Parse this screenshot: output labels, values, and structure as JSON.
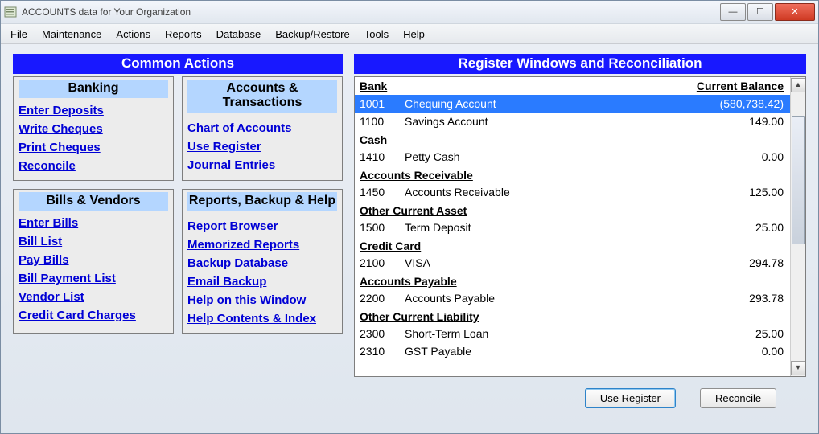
{
  "window": {
    "title": "ACCOUNTS data for Your Organization"
  },
  "menus": [
    "File",
    "Maintenance",
    "Actions",
    "Reports",
    "Database",
    "Backup/Restore",
    "Tools",
    "Help"
  ],
  "left_section_title": "Common Actions",
  "right_section_title": "Register Windows and Reconciliation",
  "panels": {
    "banking": {
      "title": "Banking",
      "links": [
        "Enter Deposits",
        "Write Cheques",
        "Print Cheques",
        "Reconcile"
      ]
    },
    "accounts_trans": {
      "title": "Accounts & Transactions",
      "links": [
        "Chart of Accounts",
        "Use Register",
        "Journal Entries"
      ]
    },
    "bills_vendors": {
      "title": "Bills & Vendors",
      "links": [
        "Enter Bills",
        "Bill List",
        "Pay Bills",
        "Bill Payment List",
        "Vendor List",
        "Credit Card Charges"
      ]
    },
    "reports_help": {
      "title": "Reports, Backup & Help",
      "links": [
        "Report Browser",
        "Memorized Reports",
        "Backup Database",
        "Email Backup",
        "Help on this Window",
        "Help Contents & Index"
      ]
    }
  },
  "register": {
    "headers": {
      "bank": "Bank",
      "balance": "Current Balance"
    },
    "groups": [
      {
        "category": "Bank",
        "show_header_balance": true,
        "accounts": [
          {
            "code": "1001",
            "name": "Chequing Account",
            "balance": "(580,738.42)",
            "selected": true
          },
          {
            "code": "1100",
            "name": "Savings Account",
            "balance": "149.00"
          }
        ]
      },
      {
        "category": "Cash",
        "accounts": [
          {
            "code": "1410",
            "name": "Petty Cash",
            "balance": "0.00"
          }
        ]
      },
      {
        "category": "Accounts Receivable",
        "accounts": [
          {
            "code": "1450",
            "name": "Accounts Receivable",
            "balance": "125.00"
          }
        ]
      },
      {
        "category": "Other Current Asset",
        "accounts": [
          {
            "code": "1500",
            "name": "Term Deposit",
            "balance": "25.00"
          }
        ]
      },
      {
        "category": "Credit Card",
        "accounts": [
          {
            "code": "2100",
            "name": "VISA",
            "balance": "294.78"
          }
        ]
      },
      {
        "category": "Accounts Payable",
        "accounts": [
          {
            "code": "2200",
            "name": "Accounts Payable",
            "balance": "293.78"
          }
        ]
      },
      {
        "category": "Other Current Liability",
        "accounts": [
          {
            "code": "2300",
            "name": "Short-Term Loan",
            "balance": "25.00"
          },
          {
            "code": "2310",
            "name": "GST Payable",
            "balance": "0.00"
          }
        ]
      }
    ]
  },
  "buttons": {
    "use_register": "Use Register",
    "reconcile": "Reconcile"
  }
}
